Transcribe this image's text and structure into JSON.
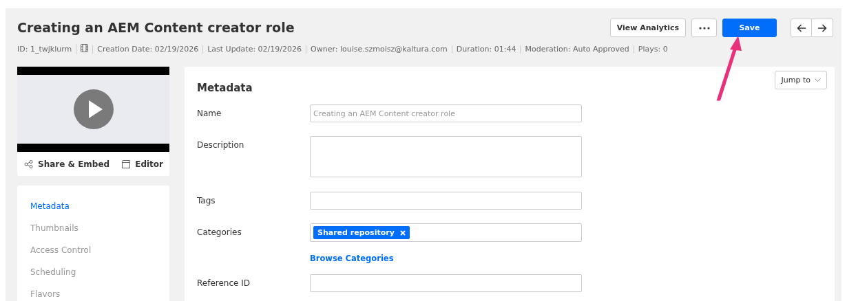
{
  "header": {
    "title": "Creating an AEM Content creator role",
    "meta": [
      {
        "kind": "text",
        "text": "ID: 1_twjklurm"
      },
      {
        "kind": "icon"
      },
      {
        "kind": "text",
        "text": "Creation Date: 02/19/2026"
      },
      {
        "kind": "text",
        "text": "Last Update: 02/19/2026"
      },
      {
        "kind": "text",
        "text": "Owner: louise.szmoisz@kaltura.com"
      },
      {
        "kind": "text",
        "text": "Duration: 01:44"
      },
      {
        "kind": "text",
        "text": "Moderation: Auto Approved"
      },
      {
        "kind": "text",
        "text": "Plays: 0"
      }
    ],
    "buttons": [
      {
        "kind": "secondary",
        "label": "View Analytics"
      },
      {
        "kind": "more"
      },
      {
        "kind": "primary",
        "label": "Save"
      }
    ]
  },
  "player": {
    "actions": [
      {
        "kind": "share",
        "label": "Share & Embed"
      },
      {
        "kind": "editor",
        "label": "Editor"
      }
    ]
  },
  "sidebar": {
    "items": [
      {
        "label": "Metadata",
        "selected": true
      },
      {
        "label": "Thumbnails",
        "selected": false
      },
      {
        "label": "Access Control",
        "selected": false
      },
      {
        "label": "Scheduling",
        "selected": false
      },
      {
        "label": "Flavors",
        "selected": false
      }
    ]
  },
  "panel": {
    "jump_to": "Jump to",
    "title": "Metadata",
    "fields": [
      {
        "kind": "input",
        "label": "Name",
        "placeholder": "Creating an AEM Content creator role"
      },
      {
        "kind": "textarea",
        "label": "Description"
      },
      {
        "kind": "input",
        "label": "Tags"
      },
      {
        "kind": "chips",
        "label": "Categories",
        "chips": [
          "Shared repository"
        ],
        "link": "Browse Categories"
      },
      {
        "kind": "input",
        "label": "Reference ID"
      }
    ]
  },
  "annotation": {
    "color": "#e8317a"
  }
}
